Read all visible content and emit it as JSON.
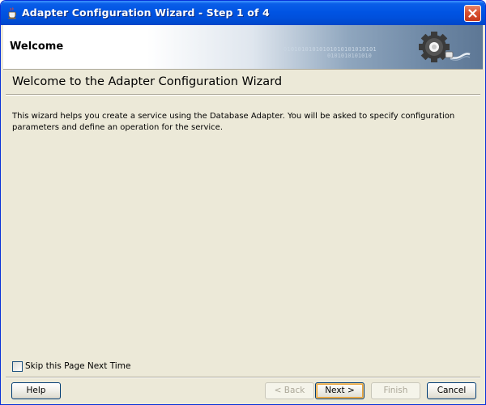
{
  "window": {
    "title": "Adapter Configuration Wizard - Step 1 of 4"
  },
  "header": {
    "title": "Welcome",
    "binary_line_1": "01010101010101010101010101",
    "binary_line_2": "0101010101010"
  },
  "content": {
    "heading": "Welcome to the Adapter Configuration Wizard",
    "description": "This wizard helps you create a service using the Database Adapter. You will be asked to specify configuration parameters and define an operation for the service."
  },
  "skip_option": {
    "label": "Skip this Page Next Time",
    "checked": false
  },
  "buttons": {
    "help": "Help",
    "back": "< Back",
    "next": "Next >",
    "finish": "Finish",
    "cancel": "Cancel"
  },
  "colors": {
    "titlebar": "#0054e3",
    "close_button": "#d8502f",
    "dialog_background": "#ece9d8",
    "disabled_text": "#aca899"
  },
  "icons": {
    "app": "coffee-cup-icon",
    "close": "close-x-icon",
    "banner": "gear-plug-icon"
  }
}
